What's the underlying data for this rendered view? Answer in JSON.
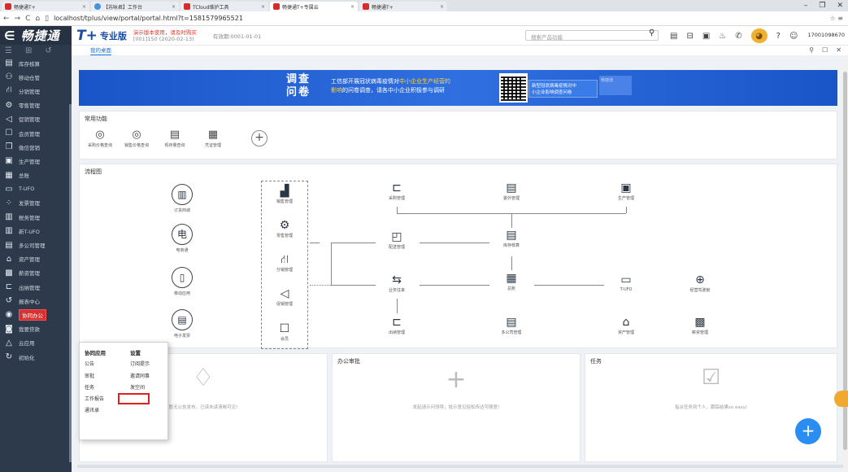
{
  "browser": {
    "tabs": [
      {
        "label": "畅捷通T+",
        "active": false
      },
      {
        "label": "【苏咏君】工作台",
        "active": false
      },
      {
        "label": "TCloud维护工具",
        "active": false
      },
      {
        "label": "畅捷通T+专属云",
        "active": true
      },
      {
        "label": "畅捷通T+",
        "active": false
      }
    ],
    "url": "localhost/tplus/view/portal/portal.html?t=1581579965521",
    "window_controls": [
      "–",
      "❐",
      "✕"
    ]
  },
  "sidebar": {
    "logo": "畅捷通",
    "items": [
      {
        "label": "库存核算",
        "icon": "warehouse-icon",
        "glyph": "▤"
      },
      {
        "label": "移动仓管",
        "icon": "mobile-warehouse-icon",
        "glyph": "⚇"
      },
      {
        "label": "分销管理",
        "icon": "distribution-icon",
        "glyph": "⛙"
      },
      {
        "label": "零售管理",
        "icon": "retail-icon",
        "glyph": "⚙"
      },
      {
        "label": "促销管理",
        "icon": "promotion-icon",
        "glyph": "◁"
      },
      {
        "label": "会员管理",
        "icon": "member-icon",
        "glyph": "☐"
      },
      {
        "label": "微信营销",
        "icon": "wechat-icon",
        "glyph": "❐"
      },
      {
        "label": "生产管理",
        "icon": "production-icon",
        "glyph": "▣"
      },
      {
        "label": "总账",
        "icon": "ledger-icon",
        "glyph": "▦"
      },
      {
        "label": "T-UFO",
        "icon": "ufo-icon",
        "glyph": "▭"
      },
      {
        "label": "发票管理",
        "icon": "invoice-icon",
        "glyph": "⁘"
      },
      {
        "label": "税务管理",
        "icon": "tax-icon",
        "glyph": "▥"
      },
      {
        "label": "新T-UFO",
        "icon": "new-ufo-icon",
        "glyph": "▥"
      },
      {
        "label": "多公司管理",
        "icon": "multi-company-icon",
        "glyph": "▤"
      },
      {
        "label": "资产管理",
        "icon": "asset-icon",
        "glyph": "⌂"
      },
      {
        "label": "薪资管理",
        "icon": "salary-icon",
        "glyph": "▩"
      },
      {
        "label": "出纳管理",
        "icon": "cashier-icon",
        "glyph": "⊏"
      },
      {
        "label": "报表中心",
        "icon": "report-icon",
        "glyph": "↺"
      },
      {
        "label": "协同办公",
        "icon": "collab-icon",
        "glyph": "◉",
        "active": true
      },
      {
        "label": "我要贷款",
        "icon": "loan-icon",
        "glyph": "◙"
      },
      {
        "label": "云应用",
        "icon": "cloud-app-icon",
        "glyph": "△"
      },
      {
        "label": "初始化",
        "icon": "init-icon",
        "glyph": "↻"
      }
    ]
  },
  "header": {
    "brand_mark": "T+",
    "brand_name": "专业版",
    "demo_note": "演示版本使用，请及时购买",
    "account": "[001]150    (2020-02-13)",
    "valid_until": "有效期:0001-01-01",
    "search_placeholder": "搜索产品功能",
    "user_id": "17001098670"
  },
  "workspace_tab": "我的桌面",
  "banner": {
    "big1": "调查",
    "big2": "问卷",
    "line1a": "工信部开展冠状病毒疫情对",
    "line1b": "中小企业生产经营的",
    "line2a": "影响",
    "line2b": "的问卷调查，请各中小企业积极参与调研",
    "card_l1": "新型冠状病毒疫情对中",
    "card_l2": "小企业影响调查问卷",
    "card2_brand": "畅捷通"
  },
  "common_functions": {
    "title": "常用功能",
    "items": [
      {
        "label": "采购价格查询",
        "glyph": "◎"
      },
      {
        "label": "销售价格查询",
        "glyph": "◎"
      },
      {
        "label": "现存量查询",
        "glyph": "▤"
      },
      {
        "label": "凭证管理",
        "glyph": "▦"
      }
    ],
    "add": "+"
  },
  "flowchart": {
    "title": "流程图",
    "nodes": {
      "order_mall": "订货商城",
      "ecommerce": "电商通",
      "mobile_app": "移动应用",
      "e_invoice": "电子发票",
      "sales": "销售管理",
      "retail": "零售管理",
      "distribution": "分销管理",
      "promotion": "促销管理",
      "member": "会员",
      "purchase": "采购管理",
      "outsource": "委外管理",
      "production": "生产管理",
      "delivery": "配送管理",
      "inventory": "库存核算",
      "business": "业务往来",
      "gl": "总账",
      "tufo": "T-UFO",
      "analysis": "经营驾驶舱",
      "cashier": "出纳管理",
      "multi": "多公司管理",
      "asset": "资产管理",
      "salary": "薪资管理"
    }
  },
  "panels": {
    "notice_msg": "暂无公告发布，已读未读清晰可见!",
    "office": {
      "title": "办公审批",
      "msg": "发起请示问领导，批示意见轻松传达可随意!"
    },
    "task": {
      "title": "任务",
      "msg": "指派任务到个人，跟踪结果so easy!"
    }
  },
  "popup": {
    "col1": {
      "title": "协同应用",
      "items": [
        "公告",
        "审批",
        "任务",
        "工作报告",
        "通讯录"
      ]
    },
    "col2": {
      "title": "设置",
      "items": [
        "订阅提示",
        "邀请同事",
        "发空间"
      ]
    }
  },
  "fab": "+",
  "colors": {
    "sidebar": "#2d3a4b",
    "accent": "#2b8cf2",
    "highlight": "#e02020",
    "banner": "#1a55c8"
  }
}
